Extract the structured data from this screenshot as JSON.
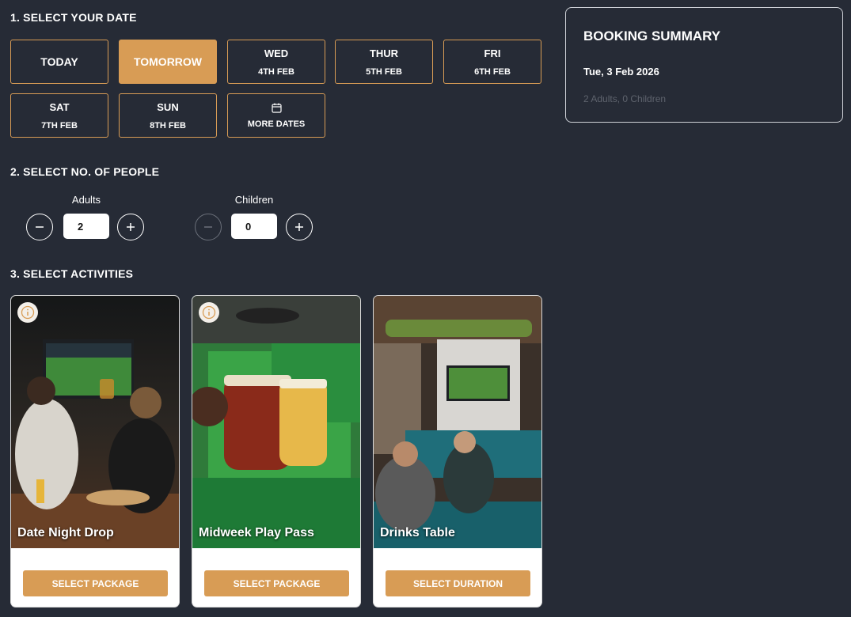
{
  "sections": {
    "date_title": "1. SELECT YOUR DATE",
    "people_title": "2. SELECT NO. OF PEOPLE",
    "activities_title": "3. SELECT ACTIVITIES"
  },
  "dates": [
    {
      "label": "TODAY",
      "sub": "",
      "selected": false
    },
    {
      "label": "TOMORROW",
      "sub": "",
      "selected": true
    },
    {
      "label": "WED",
      "sub": "4TH FEB",
      "selected": false
    },
    {
      "label": "THUR",
      "sub": "5TH FEB",
      "selected": false
    },
    {
      "label": "FRI",
      "sub": "6TH FEB",
      "selected": false
    },
    {
      "label": "SAT",
      "sub": "7TH FEB",
      "selected": false
    },
    {
      "label": "SUN",
      "sub": "8TH FEB",
      "selected": false
    },
    {
      "label": "",
      "sub": "MORE DATES",
      "icon": "calendar-icon",
      "selected": false
    }
  ],
  "people": {
    "adults": {
      "label": "Adults",
      "value": "2"
    },
    "children": {
      "label": "Children",
      "value": "0"
    }
  },
  "activities": [
    {
      "title": "Date Night Drop",
      "cta": "SELECT PACKAGE",
      "has_info": true
    },
    {
      "title": "Midweek Play Pass",
      "cta": "SELECT PACKAGE",
      "has_info": true
    },
    {
      "title": "Drinks Table",
      "cta": "SELECT DURATION",
      "has_info": false
    }
  ],
  "summary": {
    "title": "BOOKING SUMMARY",
    "date": "Tue, 3 Feb 2026",
    "people": "2 Adults, 0 Children"
  },
  "colors": {
    "background": "#262b36",
    "accent": "#d89c55",
    "card": "#ffffff"
  }
}
